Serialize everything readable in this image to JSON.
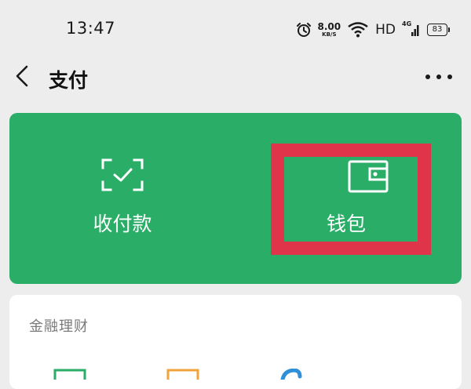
{
  "status_bar": {
    "time": "13:47",
    "net_speed_value": "8.00",
    "net_speed_unit": "KB/S",
    "hd_label": "HD",
    "signal_label": "4G",
    "battery_level": "83"
  },
  "nav": {
    "title": "支付"
  },
  "payment_card": {
    "background": "#2aae67",
    "actions": [
      {
        "label": "收付款",
        "icon": "scan-check-icon"
      },
      {
        "label": "钱包",
        "icon": "wallet-icon"
      }
    ],
    "highlight_color": "#e0344a"
  },
  "finance_section": {
    "title": "金融理财",
    "icons": [
      "finance-icon-green",
      "finance-icon-orange",
      "finance-icon-blue"
    ]
  }
}
